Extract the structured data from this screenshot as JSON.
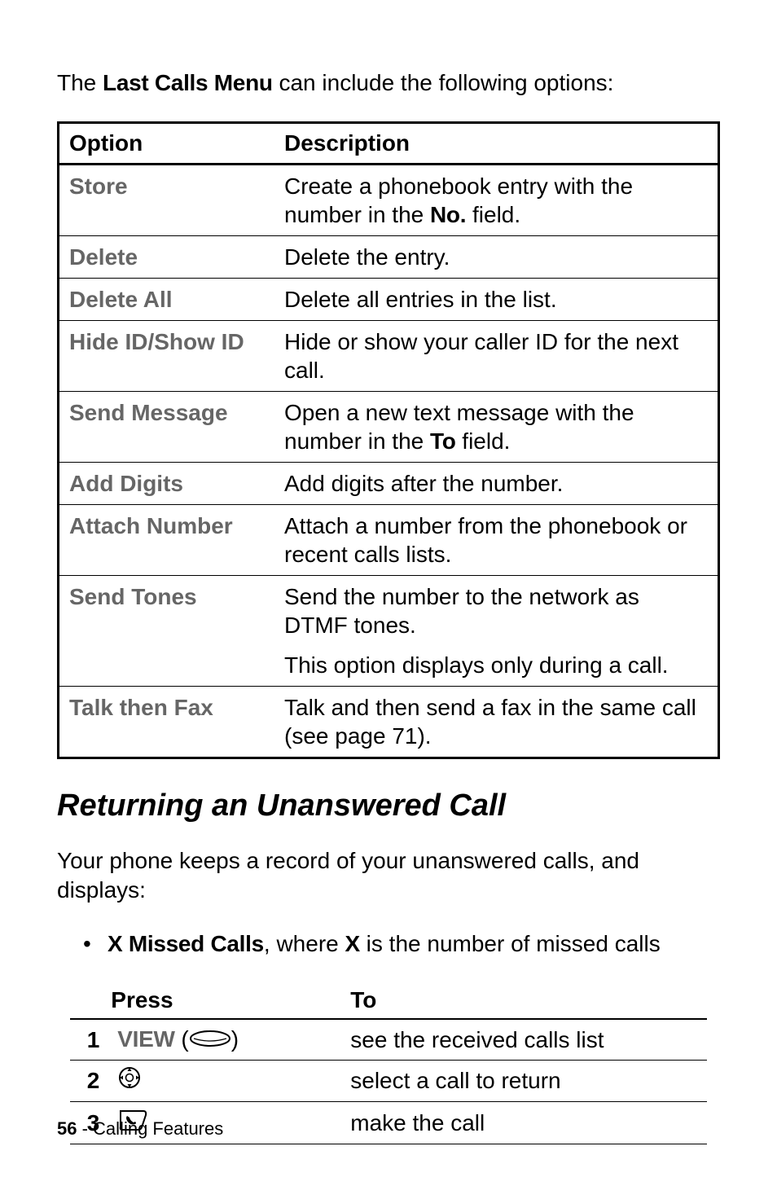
{
  "intro_prefix": "The ",
  "intro_bold": "Last Calls Menu",
  "intro_suffix": " can include the following options:",
  "options_table": {
    "head_option": "Option",
    "head_description": "Description",
    "rows": [
      {
        "option": "Store",
        "desc_before": "Create a phonebook entry with the number in the ",
        "desc_bold": "No.",
        "desc_after": " field."
      },
      {
        "option": "Delete",
        "desc_before": "Delete the entry.",
        "desc_bold": "",
        "desc_after": ""
      },
      {
        "option": "Delete All",
        "desc_before": "Delete all entries in the list.",
        "desc_bold": "",
        "desc_after": ""
      },
      {
        "option": "Hide ID/Show ID",
        "desc_before": "Hide or show your caller ID for the next call.",
        "desc_bold": "",
        "desc_after": ""
      },
      {
        "option": "Send Message",
        "desc_before": "Open a new text message with the number in the ",
        "desc_bold": "To",
        "desc_after": " field."
      },
      {
        "option": "Add Digits",
        "desc_before": "Add digits after the number.",
        "desc_bold": "",
        "desc_after": ""
      },
      {
        "option": "Attach Number",
        "desc_before": "Attach a number from the phonebook or recent calls lists.",
        "desc_bold": "",
        "desc_after": ""
      },
      {
        "option": "Send Tones",
        "desc_before": "Send the number to the network as DTMF tones.",
        "desc_bold": "",
        "desc_after": "",
        "desc_extra": "This option displays only during a call."
      },
      {
        "option": "Talk then Fax",
        "desc_before": "Talk and then send a fax in the same call (see page 71).",
        "desc_bold": "",
        "desc_after": ""
      }
    ]
  },
  "section_heading": "Returning an Unanswered Call",
  "section_intro": "Your phone keeps a record of your unanswered calls, and displays:",
  "bullet_pre_bold": "X Missed Calls",
  "bullet_mid": ", where ",
  "bullet_bold2": "X",
  "bullet_post": " is the number of missed calls",
  "steps_table": {
    "head_press": "Press",
    "head_to": "To",
    "rows": [
      {
        "num": "1",
        "press_label": "VIEW",
        "press_icon": "softkey",
        "to": "see the received calls list"
      },
      {
        "num": "2",
        "press_label": "",
        "press_icon": "nav",
        "to": "select a call to return"
      },
      {
        "num": "3",
        "press_label": "",
        "press_icon": "send",
        "to": "make the call"
      }
    ]
  },
  "footer_page": "56",
  "footer_sep": " - ",
  "footer_text": "Calling Features"
}
